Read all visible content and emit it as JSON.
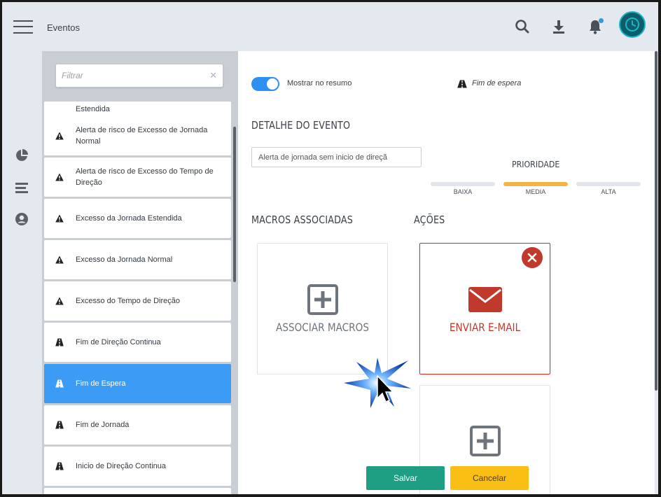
{
  "header": {
    "title": "Eventos",
    "icons": [
      "menu-icon",
      "search-icon",
      "download-icon",
      "bell-icon",
      "avatar"
    ]
  },
  "rail": {
    "icons": [
      "pie-chart-icon",
      "list-icon",
      "user-circle-icon"
    ]
  },
  "list": {
    "filter_placeholder": "Filtrar",
    "partial_item_label": "Estendida",
    "items": [
      {
        "label": "Alerta de risco de Excesso de Jornada Normal",
        "icon": "warning-icon"
      },
      {
        "label": "Alerta de risco de Excesso do Tempo de Direção",
        "icon": "warning-icon"
      },
      {
        "label": "Excesso da Jornada Estendida",
        "icon": "warning-icon"
      },
      {
        "label": "Excesso da Jornada Normal",
        "icon": "warning-icon"
      },
      {
        "label": "Excesso do Tempo de Direção",
        "icon": "warning-icon"
      },
      {
        "label": "Fim de Direção Continua",
        "icon": "road-icon"
      },
      {
        "label": "Fim de Espera",
        "icon": "road-icon",
        "selected": true
      },
      {
        "label": "Fim de Jornada",
        "icon": "road-icon"
      },
      {
        "label": "Inicio de Direção Continua",
        "icon": "road-icon"
      }
    ]
  },
  "detail": {
    "toggle_label": "Mostrar no resumo",
    "toggle_on": true,
    "event_type": "Fim de espera",
    "event_type_icon": "road-icon",
    "section_detail": "DETALHE DO EVENTO",
    "detail_input_value": "Alerta de jornada sem inicio de direçã",
    "priority": {
      "title": "PRIORIDADE",
      "levels": [
        "BAIXA",
        "MEDIA",
        "ALTA"
      ],
      "selected": "MEDIA"
    },
    "section_macros": "MACROS ASSOCIADAS",
    "section_actions": "AÇÕES",
    "associate_macros_label": "ASSOCIAR MACROS",
    "email_action_label": "ENVIAR E-MAIL"
  },
  "footer": {
    "save_label": "Salvar",
    "cancel_label": "Cancelar"
  },
  "colors": {
    "accent_blue": "#3c9bf4",
    "toggle_blue": "#2d8ff0",
    "priority_active": "#f3b547",
    "email_red": "#c0392b",
    "save_green": "#1e9e82",
    "cancel_yellow": "#fbbf13",
    "avatar_teal": "#0b5e6b"
  }
}
